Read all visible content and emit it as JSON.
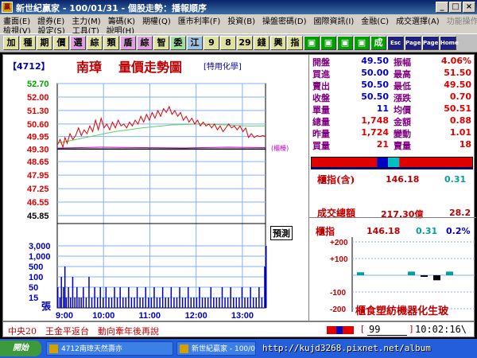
{
  "window": {
    "title": "新世紀贏家 - 100/01/31 - 個股走勢：播報順序",
    "min": "_",
    "max": "□",
    "close": "×"
  },
  "menu": {
    "row1": [
      {
        "label": "畫面(E)",
        "enabled": true
      },
      {
        "label": "證券(E)",
        "enabled": true
      },
      {
        "label": "主力(M)",
        "enabled": true
      },
      {
        "label": "籌碼(K)",
        "enabled": true
      },
      {
        "label": "期權(Q)",
        "enabled": true
      },
      {
        "label": "匯市利率(F)",
        "enabled": true
      },
      {
        "label": "投資(B)",
        "enabled": true
      },
      {
        "label": "操盤密碼(D)",
        "enabled": true
      },
      {
        "label": "國際資訊(I)",
        "enabled": true
      },
      {
        "label": "金融(C)",
        "enabled": true
      },
      {
        "label": "成交選擇(A)",
        "enabled": true
      },
      {
        "label": "功能操作(F)",
        "enabled": false
      }
    ],
    "row2": [
      {
        "label": "檢視(V)",
        "enabled": true
      },
      {
        "label": "設定(S)",
        "enabled": true
      },
      {
        "label": "工具(T)",
        "enabled": true
      },
      {
        "label": "說明(H)",
        "enabled": true
      }
    ]
  },
  "toolbar": [
    {
      "label": "加",
      "bg": "#e0e0a0"
    },
    {
      "label": "種",
      "bg": "#e0e0a0"
    },
    {
      "label": "期",
      "bg": "#e0e0a0"
    },
    {
      "label": "價",
      "bg": "#e0e0a0"
    },
    {
      "label": "選",
      "bg": "#e0a0e0"
    },
    {
      "label": "綜",
      "bg": "#e0e0a0"
    },
    {
      "label": "類",
      "bg": "#e0e0a0"
    },
    {
      "label": "盾",
      "bg": "#e0a0e0"
    },
    {
      "label": "綜",
      "bg": "#e0a0e0"
    },
    {
      "label": "智",
      "bg": "#e0e0a0"
    },
    {
      "label": "委",
      "bg": "#a0e0a0"
    },
    {
      "label": "江",
      "bg": "#a0c0e0"
    },
    {
      "label": "9",
      "bg": "#e0e0a0"
    },
    {
      "label": "8",
      "bg": "#e0e0a0"
    },
    {
      "label": "29",
      "bg": "#e0e0a0"
    },
    {
      "label": "錢",
      "bg": "#e0e0a0"
    },
    {
      "label": "興",
      "bg": "#e0e0a0"
    },
    {
      "label": "指",
      "bg": "#e0e0a0"
    },
    {
      "label": "▣",
      "bg": "#00a000"
    },
    {
      "label": "▣",
      "bg": "#00a000"
    },
    {
      "label": "▣",
      "bg": "#00a000"
    },
    {
      "label": "▣",
      "bg": "#00a000"
    },
    {
      "label": "成",
      "bg": "#00a000"
    },
    {
      "label": "Esc",
      "bg": "#202080"
    },
    {
      "label": "Page",
      "bg": "#202080"
    },
    {
      "label": "Page",
      "bg": "#202080"
    },
    {
      "label": "Home",
      "bg": "#202080"
    }
  ],
  "stock": {
    "code": "【4712】",
    "name": "南璋",
    "chart_title": "量價走勢圖",
    "industry": "[特用化學]",
    "stop_label": "(櫃檯)",
    "predict_label": "預測"
  },
  "chart_data": {
    "type": "line",
    "price_axis": {
      "ticks": [
        "52.70",
        "52.00",
        "51.30",
        "50.60",
        "49.95",
        "49.30",
        "48.65",
        "47.95",
        "47.25",
        "46.55",
        "45.85"
      ],
      "tick_values": [
        52.7,
        52.0,
        51.3,
        50.6,
        49.95,
        49.3,
        48.65,
        47.95,
        47.25,
        46.55,
        45.85
      ],
      "tick_colors": [
        "#00a000",
        "#e00000",
        "#e00000",
        "#e00000",
        "#e00000",
        "#e00000",
        "#e00000",
        "#e00000",
        "#e00000",
        "#e00000",
        "#000000"
      ],
      "ref_price": 49.3,
      "ylim": [
        45.85,
        52.7
      ]
    },
    "volume_axis": {
      "ticks": [
        "3,000",
        "1,000",
        "500",
        "100",
        "50",
        "15"
      ],
      "unit": "張"
    },
    "time_axis": {
      "ticks": [
        "9:00",
        "10:00",
        "11:00",
        "12:00",
        "13:00"
      ]
    },
    "price_series": [
      [
        0,
        49.5
      ],
      [
        4,
        49.8
      ],
      [
        8,
        49.4
      ],
      [
        11,
        49.9
      ],
      [
        14,
        49.6
      ],
      [
        18,
        50.1
      ],
      [
        22,
        49.8
      ],
      [
        26,
        50.0
      ],
      [
        30,
        50.4
      ],
      [
        34,
        50.0
      ],
      [
        38,
        50.3
      ],
      [
        42,
        50.1
      ],
      [
        46,
        50.5
      ],
      [
        50,
        50.2
      ],
      [
        54,
        50.8
      ],
      [
        58,
        50.3
      ],
      [
        62,
        50.9
      ],
      [
        66,
        50.4
      ],
      [
        70,
        50.6
      ],
      [
        74,
        50.3
      ],
      [
        78,
        50.7
      ],
      [
        82,
        50.4
      ],
      [
        86,
        50.8
      ],
      [
        90,
        50.5
      ],
      [
        94,
        50.6
      ],
      [
        98,
        50.4
      ],
      [
        102,
        50.7
      ],
      [
        106,
        50.5
      ],
      [
        110,
        50.8
      ],
      [
        114,
        50.6
      ],
      [
        118,
        51.0
      ],
      [
        122,
        50.7
      ],
      [
        126,
        51.1
      ],
      [
        130,
        50.8
      ],
      [
        134,
        51.2
      ],
      [
        138,
        50.9
      ],
      [
        142,
        51.3
      ],
      [
        146,
        51.0
      ],
      [
        150,
        51.4
      ],
      [
        154,
        51.2
      ],
      [
        158,
        51.5
      ],
      [
        162,
        51.1
      ],
      [
        166,
        51.3
      ],
      [
        170,
        51.0
      ],
      [
        174,
        51.2
      ],
      [
        178,
        50.8
      ],
      [
        182,
        51.0
      ],
      [
        186,
        50.7
      ],
      [
        190,
        50.9
      ],
      [
        194,
        50.6
      ],
      [
        198,
        50.8
      ],
      [
        202,
        50.5
      ],
      [
        206,
        50.7
      ],
      [
        210,
        50.5
      ],
      [
        214,
        50.6
      ],
      [
        218,
        50.4
      ],
      [
        222,
        50.6
      ],
      [
        226,
        50.3
      ],
      [
        230,
        50.5
      ],
      [
        234,
        50.2
      ],
      [
        238,
        50.4
      ],
      [
        242,
        50.6
      ],
      [
        246,
        50.4
      ],
      [
        250,
        50.5
      ],
      [
        254,
        50.3
      ],
      [
        258,
        50.5
      ],
      [
        262,
        50.2
      ],
      [
        266,
        50.4
      ],
      [
        270,
        49.9
      ],
      [
        274,
        50.1
      ],
      [
        278,
        49.9
      ],
      [
        282,
        50.0
      ],
      [
        286,
        49.95
      ],
      [
        290,
        50.0
      ],
      [
        294,
        49.95
      ]
    ],
    "avg_series": [
      [
        0,
        49.6
      ],
      [
        40,
        49.9
      ],
      [
        80,
        50.2
      ],
      [
        120,
        50.4
      ],
      [
        160,
        50.55
      ],
      [
        200,
        50.6
      ],
      [
        240,
        50.55
      ],
      [
        270,
        50.5
      ],
      [
        294,
        50.51
      ]
    ],
    "index_series": [
      [
        0,
        49.35
      ],
      [
        60,
        49.4
      ],
      [
        120,
        49.38
      ],
      [
        180,
        49.36
      ],
      [
        240,
        49.4
      ],
      [
        294,
        49.38
      ]
    ],
    "volume_series": [
      [
        0,
        2
      ],
      [
        3,
        1
      ],
      [
        5,
        3
      ],
      [
        8,
        2
      ],
      [
        10,
        4
      ],
      [
        12,
        1
      ],
      [
        15,
        2
      ],
      [
        18,
        1
      ],
      [
        21,
        3
      ],
      [
        24,
        1
      ],
      [
        27,
        2
      ],
      [
        30,
        1
      ],
      [
        33,
        1
      ],
      [
        36,
        2
      ],
      [
        40,
        1
      ],
      [
        44,
        3
      ],
      [
        48,
        1
      ],
      [
        52,
        2
      ],
      [
        56,
        1
      ],
      [
        60,
        2
      ],
      [
        64,
        1
      ],
      [
        68,
        2
      ],
      [
        72,
        1
      ],
      [
        76,
        1
      ],
      [
        80,
        2
      ],
      [
        84,
        1
      ],
      [
        88,
        2
      ],
      [
        92,
        1
      ],
      [
        96,
        1
      ],
      [
        100,
        2
      ],
      [
        104,
        1
      ],
      [
        108,
        1
      ],
      [
        112,
        2
      ],
      [
        116,
        1
      ],
      [
        120,
        1
      ],
      [
        124,
        2
      ],
      [
        128,
        1
      ],
      [
        132,
        1
      ],
      [
        136,
        2
      ],
      [
        140,
        1
      ],
      [
        144,
        1
      ],
      [
        148,
        2
      ],
      [
        152,
        1
      ],
      [
        156,
        1
      ],
      [
        160,
        2
      ],
      [
        164,
        1
      ],
      [
        168,
        1
      ],
      [
        172,
        2
      ],
      [
        176,
        1
      ],
      [
        180,
        1
      ],
      [
        184,
        2
      ],
      [
        188,
        1
      ],
      [
        192,
        1
      ],
      [
        196,
        1
      ],
      [
        200,
        2
      ],
      [
        204,
        1
      ],
      [
        208,
        1
      ],
      [
        212,
        1
      ],
      [
        216,
        2
      ],
      [
        220,
        1
      ],
      [
        224,
        1
      ],
      [
        228,
        1
      ],
      [
        232,
        2
      ],
      [
        236,
        1
      ],
      [
        240,
        1
      ],
      [
        244,
        2
      ],
      [
        248,
        1
      ],
      [
        252,
        1
      ],
      [
        256,
        1
      ],
      [
        260,
        2
      ],
      [
        264,
        1
      ],
      [
        268,
        1
      ],
      [
        272,
        2
      ],
      [
        276,
        1
      ],
      [
        280,
        1
      ],
      [
        284,
        2
      ],
      [
        288,
        1
      ],
      [
        292,
        4
      ],
      [
        294,
        6
      ]
    ]
  },
  "quote": [
    {
      "l1": "開盤",
      "v1": "49.50",
      "c1": "c-blue",
      "l2": "振幅",
      "v2": "4.06%",
      "c2": "c-red"
    },
    {
      "l1": "買進",
      "v1": "50.00",
      "c1": "c-blue",
      "l2": "最高",
      "v2": "51.50",
      "c2": "c-red"
    },
    {
      "l1": "賣出",
      "v1": "50.50",
      "c1": "c-blue",
      "l2": "最低",
      "v2": "49.50",
      "c2": "c-red"
    },
    {
      "l1": "收盤",
      "v1": "50.50",
      "c1": "c-blue",
      "l2": "漲跌",
      "v2": "0.70",
      "c2": "c-red"
    },
    {
      "l1": "單量",
      "v1": "11",
      "c1": "c-blue",
      "l2": "均價",
      "v2": "50.51",
      "c2": "c-red"
    },
    {
      "l1": "總量",
      "v1": "1,748",
      "c1": "c-red",
      "l2": "金額",
      "v2": "0.88",
      "c2": "c-red"
    },
    {
      "l1": "昨量",
      "v1": "1,724",
      "c1": "c-red",
      "l2": "變動",
      "v2": "1.01",
      "c2": "c-red"
    },
    {
      "l1": "買量",
      "v1": "21",
      "c1": "c-red",
      "l2": "賣量",
      "v2": "18",
      "c2": "c-red"
    }
  ],
  "bidbar": {
    "buy_fraction": 0.54
  },
  "index": {
    "label": "櫃指(含)",
    "value": "146.18",
    "change": "0.31"
  },
  "turnover": {
    "label": "成交總額",
    "value": "217.30億",
    "ratio": "28.2"
  },
  "sector": {
    "label": "櫃指",
    "value": "146.18",
    "change": "0.31",
    "pct": "0.2%",
    "ticks": [
      "+200",
      "+100",
      "-100",
      "-200"
    ],
    "names": [
      "櫃",
      "食",
      "塑",
      "紡",
      "機",
      "器",
      "化",
      "生",
      "玻"
    ],
    "bars": [
      {
        "v": 18,
        "color": "#00a0a0"
      },
      {
        "v": 0,
        "color": "#00a0a0"
      },
      {
        "v": 0,
        "color": "#00a0a0"
      },
      {
        "v": 0,
        "color": "#00a0a0"
      },
      {
        "v": 22,
        "color": "#00a0a0"
      },
      {
        "v": -4,
        "color": "#000000"
      },
      {
        "v": -30,
        "color": "#000000"
      },
      {
        "v": 22,
        "color": "#00a0a0"
      },
      {
        "v": 0,
        "color": "#00a0a0"
      }
    ]
  },
  "status": {
    "ticker": "中央20　王金平返台　動向牽年後再說",
    "code_open": "[",
    "code_value": "99",
    "code_close": "]",
    "clock": "10:02:16\\"
  },
  "taskbar": {
    "start": "開始",
    "items": [
      "4712南璋天然壽亦",
      "新世紀贏家 - 100/01/..."
    ],
    "watermark": "http://kujd3268.pixnet.net/album"
  }
}
